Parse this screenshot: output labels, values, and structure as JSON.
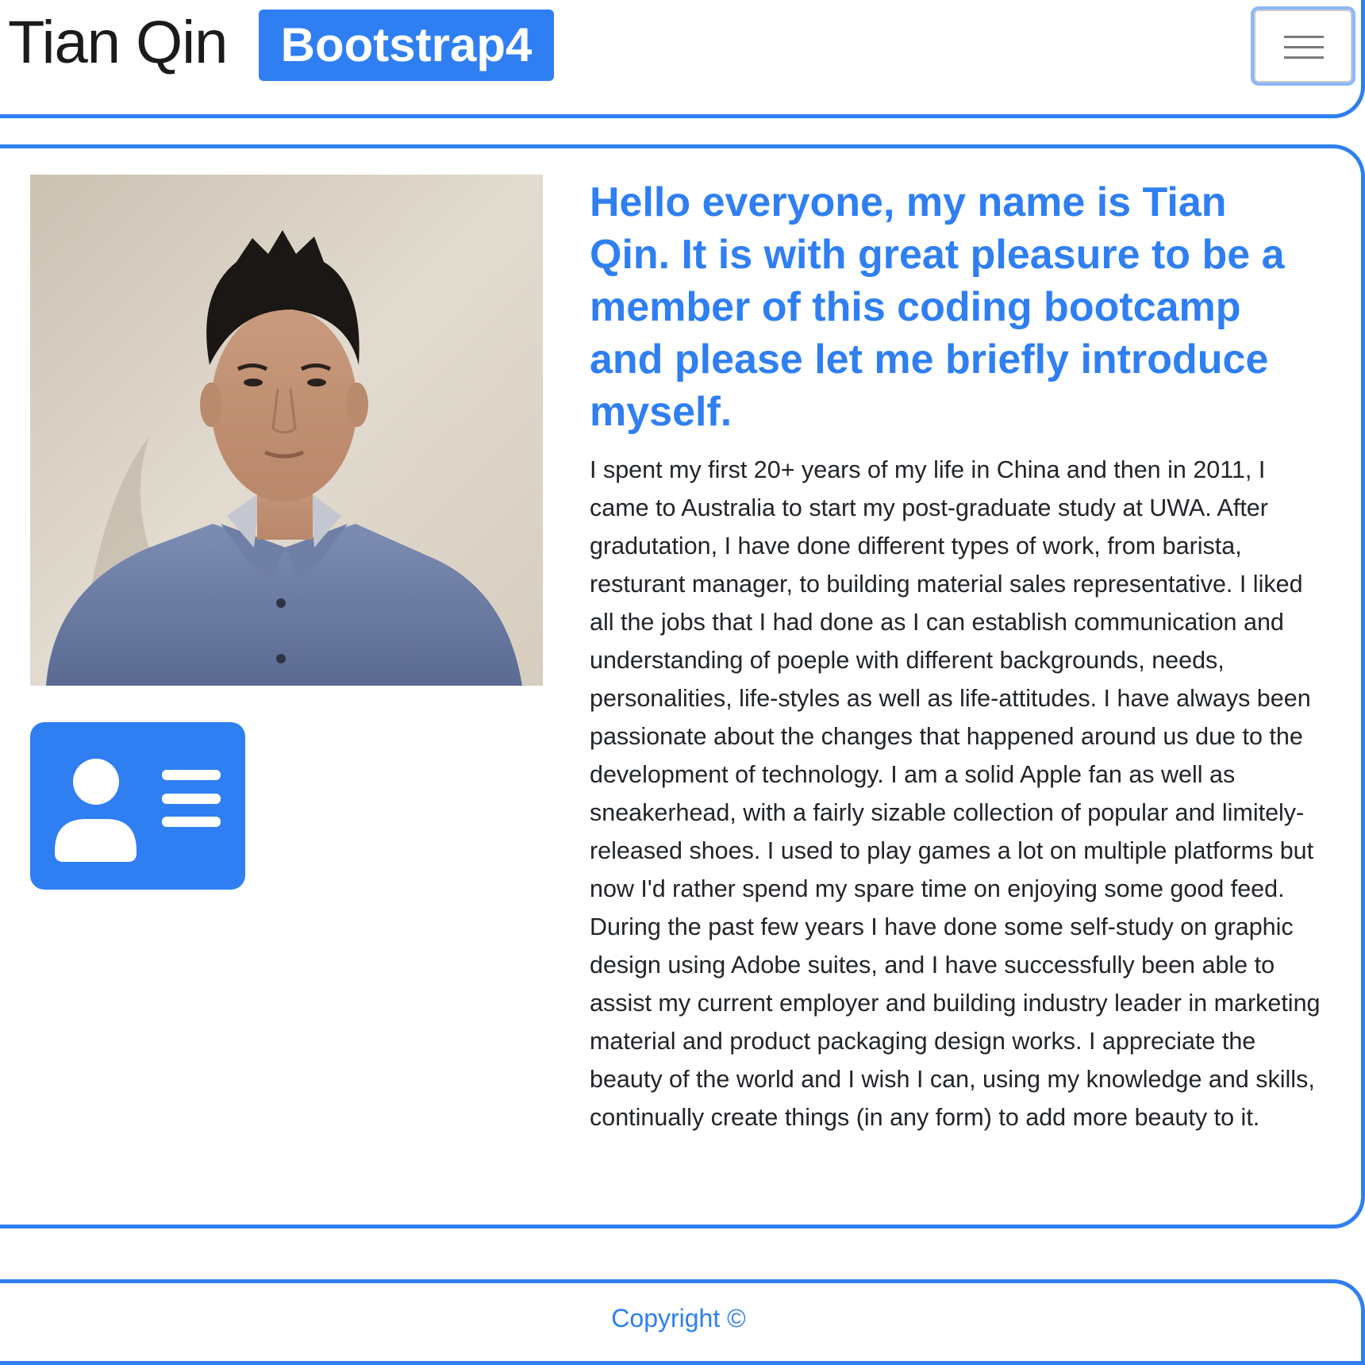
{
  "navbar": {
    "brand_name": "Tian Qin",
    "brand_badge": "Bootstrap4",
    "toggler_icon": "hamburger-menu-icon"
  },
  "profile": {
    "photo_alt": "Tian Qin",
    "contact_icon": "id-card-icon"
  },
  "main": {
    "headline": "Hello everyone, my name is Tian Qin. It is with great pleasure to be a member of this coding bootcamp and please let me briefly introduce myself.",
    "bio": "I spent my first 20+ years of my life in China and then in 2011, I came to Australia to start my post-graduate study at UWA. After gradutation, I have done different types of work, from barista, resturant manager, to building material sales representative. I liked all the jobs that I had done as I can establish communication and understanding of poeple with different backgrounds, needs, personalities, life-styles as well as life-attitudes. I have always been passionate about the changes that happened around us due to the development of technology. I am a solid Apple fan as well as sneakerhead, with a fairly sizable collection of popular and limitely-released shoes. I used to play games a lot on multiple platforms but now I'd rather spend my spare time on enjoying some good feed. During the past few years I have done some self-study on graphic design using Adobe suites, and I have successfully been able to assist my current employer and building industry leader in marketing material and product packaging design works. I appreciate the beauty of the world and I wish I can, using my knowledge and skills, continually create things (in any form) to add more beauty to it."
  },
  "footer": {
    "copyright": "Copyright ©"
  },
  "colors": {
    "accent": "#2f7ff2",
    "text": "#212529",
    "background": "#ffffff"
  }
}
